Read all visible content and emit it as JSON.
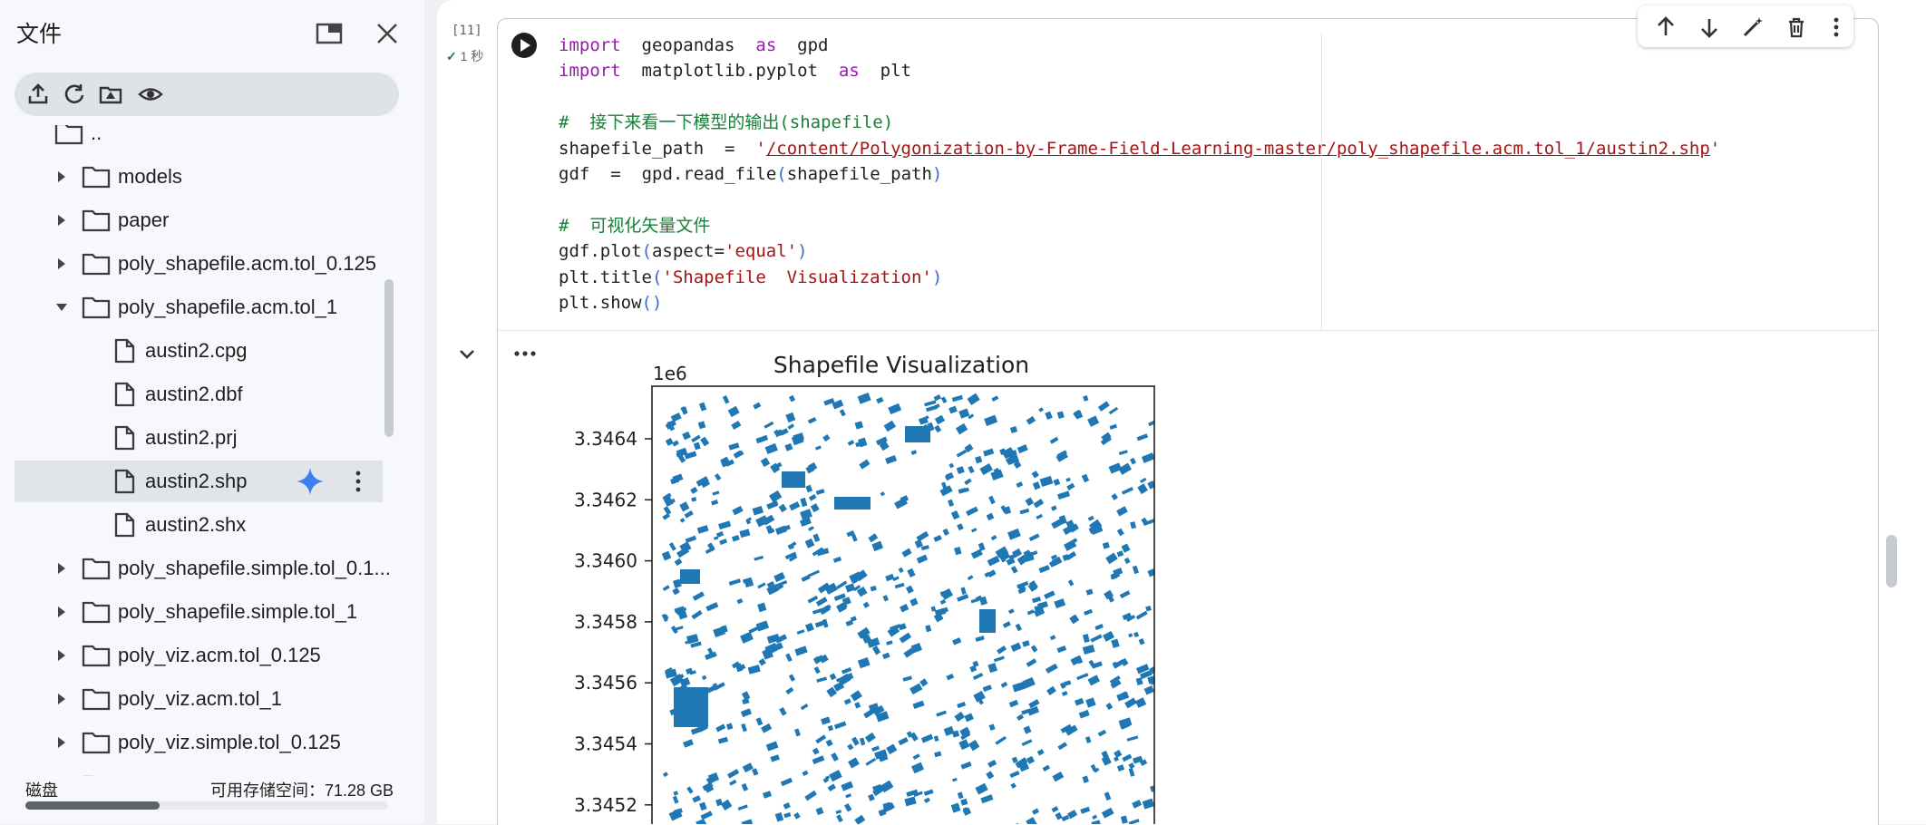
{
  "sidebar": {
    "title": "文件",
    "tree": [
      {
        "label": "..",
        "kind": "folder",
        "indent": 0,
        "arrow": "none"
      },
      {
        "label": "models",
        "kind": "folder",
        "indent": 1,
        "arrow": "right"
      },
      {
        "label": "paper",
        "kind": "folder",
        "indent": 1,
        "arrow": "right"
      },
      {
        "label": "poly_shapefile.acm.tol_0.125",
        "kind": "folder",
        "indent": 1,
        "arrow": "right"
      },
      {
        "label": "poly_shapefile.acm.tol_1",
        "kind": "folder",
        "indent": 1,
        "arrow": "down"
      },
      {
        "label": "austin2.cpg",
        "kind": "file",
        "indent": 2,
        "arrow": "none"
      },
      {
        "label": "austin2.dbf",
        "kind": "file",
        "indent": 2,
        "arrow": "none"
      },
      {
        "label": "austin2.prj",
        "kind": "file",
        "indent": 2,
        "arrow": "none"
      },
      {
        "label": "austin2.shp",
        "kind": "file",
        "indent": 2,
        "arrow": "none",
        "selected": true
      },
      {
        "label": "austin2.shx",
        "kind": "file",
        "indent": 2,
        "arrow": "none"
      },
      {
        "label": "poly_shapefile.simple.tol_0.1...",
        "kind": "folder",
        "indent": 1,
        "arrow": "right"
      },
      {
        "label": "poly_shapefile.simple.tol_1",
        "kind": "folder",
        "indent": 1,
        "arrow": "right"
      },
      {
        "label": "poly_viz.acm.tol_0.125",
        "kind": "folder",
        "indent": 1,
        "arrow": "right"
      },
      {
        "label": "poly_viz.acm.tol_1",
        "kind": "folder",
        "indent": 1,
        "arrow": "right"
      },
      {
        "label": "poly_viz.simple.tol_0.125",
        "kind": "folder",
        "indent": 1,
        "arrow": "right"
      },
      {
        "label": "poly_viz.simple.tol_1",
        "kind": "folder",
        "indent": 1,
        "arrow": "right"
      }
    ],
    "footer": {
      "disk_label": "磁盘",
      "available": "可用存储空间：71.28 GB",
      "disk_used_fraction": 0.37
    }
  },
  "cell": {
    "exec_count": "[11]",
    "exec_time": "1 秒",
    "code": {
      "l1": {
        "kw1": "import",
        "mod": "geopandas",
        "kw2": "as",
        "alias": "gpd"
      },
      "l2": {
        "kw1": "import",
        "mod": "matplotlib.pyplot",
        "kw2": "as",
        "alias": "plt"
      },
      "l4": "#  接下来看一下模型的输出(shapefile)",
      "l5": {
        "var": "shapefile_path",
        "eq": "=",
        "q": "'",
        "path": "/content/Polygonization-by-Frame-Field-Learning-master/poly_shapefile.acm.tol_1/austin2.shp"
      },
      "l6": {
        "a": "gdf",
        "eq": "=",
        "b": "gpd.read_file",
        "p1": "(",
        "arg": "shapefile_path",
        "p2": ")"
      },
      "l8": "#  可视化矢量文件",
      "l9": {
        "a": "gdf.plot",
        "p1": "(",
        "arg": "aspect=",
        "str": "'equal'",
        "p2": ")"
      },
      "l10": {
        "a": "plt.title",
        "p1": "(",
        "str": "'Shapefile  Visualization'",
        "p2": ")"
      },
      "l11": {
        "a": "plt.show",
        "p": "()"
      }
    }
  },
  "chart_data": {
    "type": "map",
    "title": "Shapefile Visualization",
    "offset_label": "1e6",
    "yticks": [
      "3.3464",
      "3.3462",
      "3.3460",
      "3.3458",
      "3.3456",
      "3.3454",
      "3.3452"
    ],
    "fill_color": "#1f77b4",
    "grid": false
  }
}
